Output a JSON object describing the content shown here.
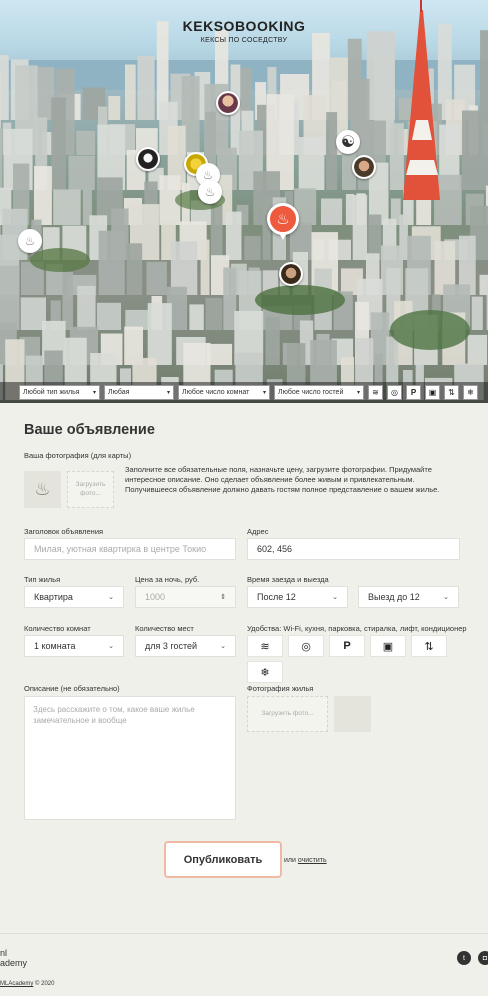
{
  "header": {
    "title": "KEKSOBOOKING",
    "subtitle": "КЕКСЫ ПО СОСЕДСТВУ"
  },
  "map": {
    "pins": [
      {
        "name": "pin-avatar-1",
        "icon": "avatar-icon"
      },
      {
        "name": "pin-avatar-2",
        "icon": "avatar-icon"
      },
      {
        "name": "pin-avatar-3",
        "icon": "avatar-icon"
      },
      {
        "name": "pin-avatar-4",
        "icon": "avatar-icon"
      },
      {
        "name": "pin-yinyang",
        "icon": "yin-yang-icon"
      },
      {
        "name": "pin-avatar-5",
        "icon": "avatar-icon"
      },
      {
        "name": "pin-muffin-1",
        "icon": "muffin-icon"
      },
      {
        "name": "pin-muffin-2",
        "icon": "muffin-icon"
      },
      {
        "name": "pin-avatar-6",
        "icon": "avatar-icon"
      }
    ],
    "main_pin_icon": "muffin-icon",
    "main_pin_color": "#ee5a3e"
  },
  "filters": {
    "type": "Любой тип жилья",
    "price": "Любая",
    "rooms": "Любое число комнат",
    "guests": "Любое число гостей",
    "features": [
      "wifi-icon",
      "dishwasher-icon",
      "parking-icon",
      "washer-icon",
      "elevator-icon",
      "conditioner-icon"
    ]
  },
  "form": {
    "title": "Ваше объявление",
    "avatar_label": "Ваша фотография (для карты)",
    "upload_label": "Загрузить фото...",
    "hint": "Заполните все обязательные поля, назначьте цену, загрузите фотографии. Придумайте интересное описание. Оно сделает объявление более живым и привлекательным. Получившееся объявление должно давать гостям полное представление о вашем жилье.",
    "title_label": "Заголовок объявления",
    "title_placeholder": "Милая, уютная квартирка в центре Токио",
    "address_label": "Адрес",
    "address_value": "602, 456",
    "type_label": "Тип жилья",
    "type_value": "Квартира",
    "price_label": "Цена за ночь, руб.",
    "price_placeholder": "1000",
    "time_label": "Время заезда и выезда",
    "checkin_value": "После 12",
    "checkout_value": "Выезд до 12",
    "rooms_label": "Количество комнат",
    "rooms_value": "1 комната",
    "capacity_label": "Количество мест",
    "capacity_value": "для 3 гостей",
    "features_label": "Удобства: Wi-Fi, кухня, парковка, стиралка, лифт, кондиционер",
    "features": [
      "wifi-icon",
      "dishwasher-icon",
      "parking-icon",
      "washer-icon",
      "elevator-icon",
      "conditioner-icon"
    ],
    "description_label": "Описание (не обязательно)",
    "description_placeholder": "Здесь расскажите о том, какое ваше жилье замечательное и вообще",
    "photos_label": "Фотография жилья",
    "photos_upload_label": "Загрузить фото...",
    "submit_label": "Опубликовать",
    "or_label": "или",
    "reset_label": "очистить"
  },
  "footer": {
    "logo_line1": "nl",
    "logo_line2": "ademy",
    "copyright_link": "MLAcademy",
    "copyright_year": "© 2020"
  }
}
